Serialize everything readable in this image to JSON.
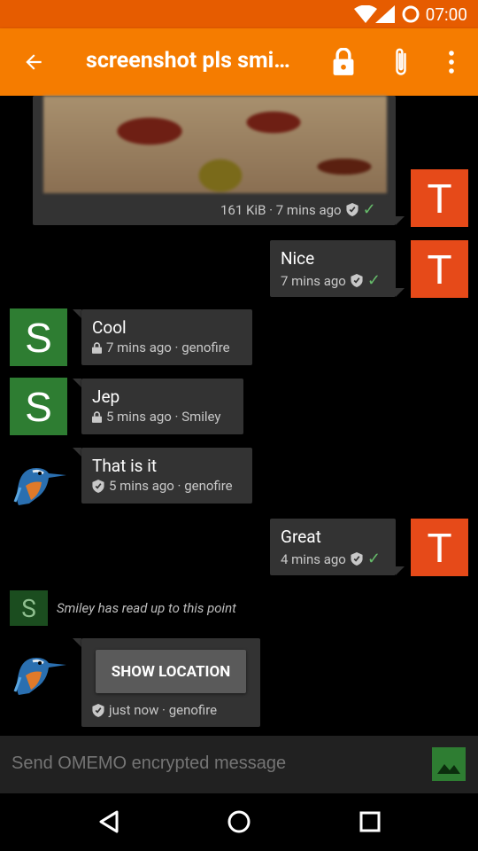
{
  "status_bar": {
    "time": "07:00"
  },
  "app_bar": {
    "title": "screenshot pls smi…",
    "icons": [
      "back-arrow-icon",
      "lock-icon",
      "attachment-icon",
      "overflow-menu-icon"
    ]
  },
  "messages": [
    {
      "type": "image",
      "meta": "161 KiB · 7 mins ago",
      "avatar": "T"
    },
    {
      "body": "Nice",
      "meta": "7 mins ago",
      "avatar": "T"
    },
    {
      "body": "Cool",
      "meta": "7 mins ago · genofire",
      "avatar": "S"
    },
    {
      "body": "Jep",
      "meta": "5 mins ago · Smiley",
      "avatar": "S"
    },
    {
      "body": "That is it",
      "meta": "5 mins ago · genofire"
    },
    {
      "body": "Great",
      "meta": "4 mins ago",
      "avatar": "T"
    }
  ],
  "read_marker": {
    "avatar": "S",
    "text": "Smiley has read up to this point"
  },
  "location_message": {
    "button": "SHOW LOCATION",
    "meta": "just now · genofire"
  },
  "composer": {
    "placeholder": "Send OMEMO encrypted message"
  },
  "colors": {
    "accent": "#f57c00",
    "status": "#e65c00",
    "avatar_t": "#e64a19",
    "avatar_s": "#2e7d32"
  }
}
